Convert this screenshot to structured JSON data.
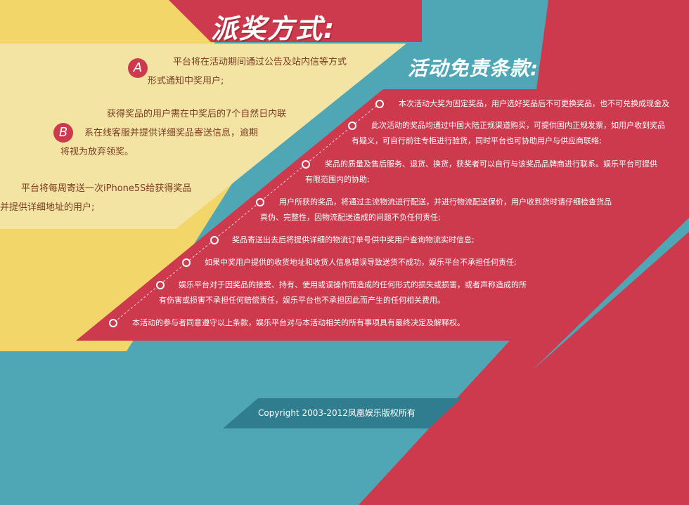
{
  "colors": {
    "background": "#4fa7b5",
    "yellow": "#f2d66a",
    "cream": "#f4e4a3",
    "red": "#cd3a4e",
    "teal_band": "#2f7d8f",
    "text_brown": "#7a3c22"
  },
  "prize_method": {
    "title": "派奖方式:",
    "items": [
      {
        "badge": "A",
        "lines": [
          "平台将在活动期间通过公告及站内信等方式",
          "形式通知中奖用户;"
        ]
      },
      {
        "badge": "B",
        "lines": [
          "获得奖品的用户需在中奖后的7个自然日内联",
          "系在线客服并提供详细奖品寄送信息，逾期",
          "将视为放弃领奖。"
        ]
      },
      {
        "badge": "",
        "lines": [
          "平台将每周寄送一次iPhone5S给获得奖品",
          "并提供详细地址的用户;"
        ]
      }
    ]
  },
  "disclaimer": {
    "title": "活动免责条款:",
    "items": [
      {
        "lines": [
          "本次活动大奖为固定奖品，用户选好奖品后不可更换奖品，也不可兑换成现金及"
        ]
      },
      {
        "lines": [
          "此次活动的奖品均通过中国大陆正规渠道购买，可提供国内正规发票，如用户收到奖品",
          "有疑义，可自行前往专柜进行验货，同时平台也可协助用户与供应商联络;"
        ]
      },
      {
        "lines": [
          "奖品的质量及售后服务、退货、换货，获奖者可以自行与该奖品品牌商进行联系。娱乐平台可提供",
          "有限范围内的协助;"
        ]
      },
      {
        "lines": [
          "用户所获的奖品，将通过主流物流进行配送，并进行物流配送保价，用户收到货时请仔细检查货品",
          "真伪、完整性，因物流配送造成的问题不负任何责任;"
        ]
      },
      {
        "lines": [
          "奖品寄送出去后将提供详细的物流订单号供中奖用户查询物流实时信息;"
        ]
      },
      {
        "lines": [
          "如果中奖用户提供的收货地址和收货人信息错误导致送货不成功，娱乐平台不承担任何责任;"
        ]
      },
      {
        "lines": [
          "娱乐平台对于因奖品的接受、持有、使用或误操作而造成的任何形式的损失或损害，或者声称造成的所",
          "有伤害或损害不承担任何赔偿责任，娱乐平台也不承担因此而产生的任何相关费用。"
        ]
      },
      {
        "lines": [
          "本活动的参与者同意遵守以上条款，娱乐平台对与本活动相关的所有事项具有最终决定及解释权。"
        ]
      }
    ]
  },
  "footer": {
    "copyright": "Copyright   2003-2012凤凰娱乐版权所有"
  }
}
